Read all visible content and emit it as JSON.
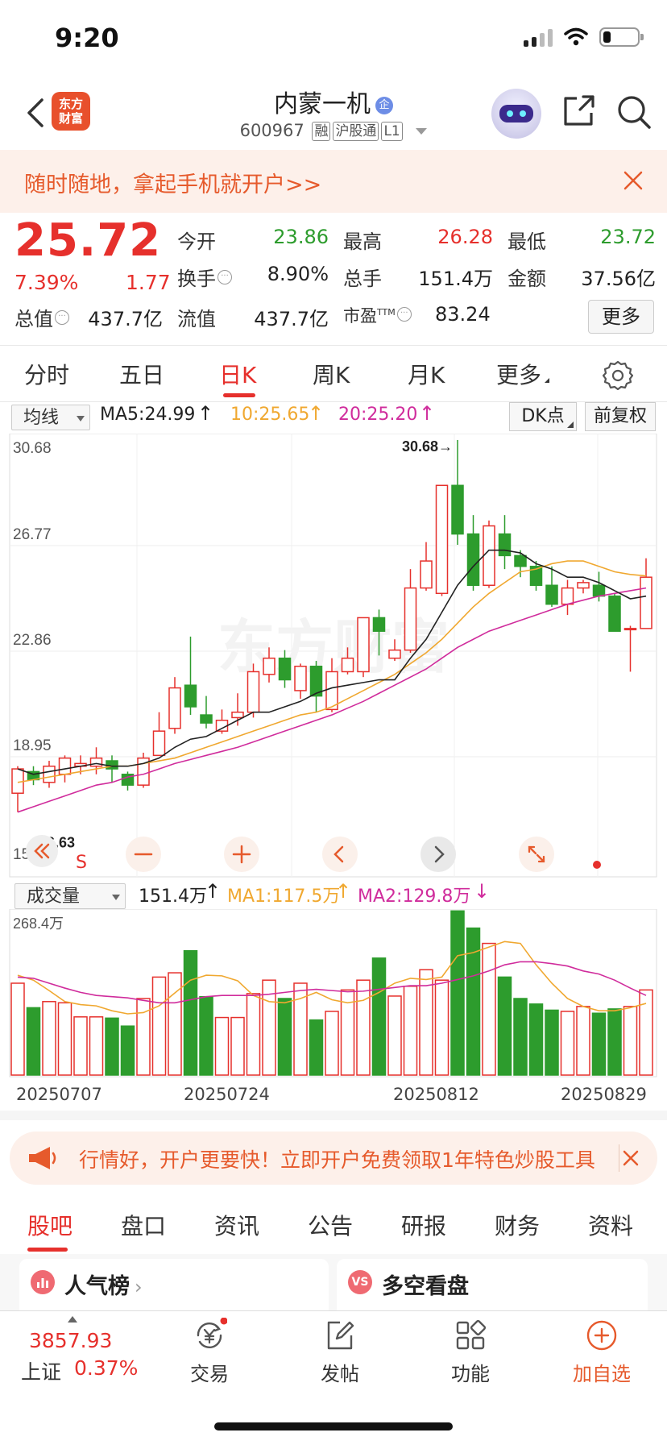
{
  "status_bar": {
    "time": "9:20",
    "battery_level": 0.22
  },
  "header": {
    "logo_line1": "东方",
    "logo_line2": "财富",
    "stock_name": "内蒙一机",
    "ent_badge": "企",
    "stock_code": "600967",
    "tags": [
      "融",
      "沪股通",
      "L1"
    ]
  },
  "promo": {
    "text": "随时随地，拿起手机就开户>>"
  },
  "quote": {
    "price": "25.72",
    "change_pct": "7.39%",
    "change": "1.77",
    "open_label": "今开",
    "open": "23.86",
    "high_label": "最高",
    "high": "26.28",
    "low_label": "最低",
    "low": "23.72",
    "turnover_label": "换手",
    "turnover": "8.90%",
    "volume_label": "总手",
    "volume": "151.4万",
    "amount_label": "金额",
    "amount": "37.56亿",
    "mcap_label": "总值",
    "mcap": "437.7亿",
    "float_label": "流值",
    "float_mcap": "437.7亿",
    "pe_label": "市盈",
    "pe_sup": "TTM",
    "pe": "83.24",
    "more_label": "更多"
  },
  "period_tabs": {
    "items": [
      "分时",
      "五日",
      "日K",
      "周K",
      "月K",
      "更多"
    ],
    "active": 2
  },
  "ma_bar": {
    "selector": "均线",
    "ma5": "MA5:24.99",
    "ma10": "10:25.65",
    "ma20": "20:25.20",
    "dk": "DK点",
    "adjust": "前复权",
    "ma5_color": "#222222",
    "ma10_color": "#f0a830",
    "ma20_color": "#d02c9c"
  },
  "vol_bar": {
    "selector": "成交量",
    "vol": "151.4万",
    "ma1": "MA1:117.5万",
    "ma2": "MA2:129.8万",
    "max_label": "268.4万"
  },
  "chart_labels": {
    "high_mark": "30.68→",
    "low_mark": "←16.63",
    "s_mark": "S",
    "watermark": "东方财富"
  },
  "chart_data": {
    "type": "candlestick",
    "y_ticks": [
      "30.68",
      "26.77",
      "22.86",
      "18.95",
      "15.04"
    ],
    "ylim": [
      15.04,
      30.68
    ],
    "x_labels": [
      "20250707",
      "20250724",
      "20250812",
      "20250829"
    ],
    "candles": [
      [
        17.6,
        18.5,
        16.9,
        18.6
      ],
      [
        18.4,
        18.1,
        17.9,
        18.6
      ],
      [
        18.0,
        18.6,
        17.8,
        18.8
      ],
      [
        18.3,
        18.9,
        18.0,
        19.0
      ],
      [
        18.6,
        18.7,
        18.3,
        19.0
      ],
      [
        18.6,
        18.9,
        18.3,
        19.3
      ],
      [
        18.8,
        18.5,
        18.0,
        19.0
      ],
      [
        18.3,
        17.9,
        17.7,
        18.4
      ],
      [
        17.9,
        18.9,
        17.8,
        19.1
      ],
      [
        19.0,
        19.9,
        19.0,
        20.6
      ],
      [
        20.0,
        21.5,
        19.8,
        21.9
      ],
      [
        21.6,
        20.8,
        20.5,
        23.4
      ],
      [
        20.5,
        20.2,
        20.0,
        21.2
      ],
      [
        19.9,
        20.3,
        19.8,
        20.7
      ],
      [
        20.4,
        20.6,
        20.1,
        21.3
      ],
      [
        20.6,
        22.1,
        20.4,
        22.4
      ],
      [
        22.0,
        22.6,
        21.7,
        23.0
      ],
      [
        22.6,
        21.8,
        21.5,
        22.9
      ],
      [
        21.4,
        22.3,
        21.1,
        22.4
      ],
      [
        22.3,
        21.2,
        20.6,
        22.5
      ],
      [
        20.7,
        22.1,
        20.6,
        22.6
      ],
      [
        22.1,
        22.6,
        22.0,
        23.0
      ],
      [
        22.1,
        24.1,
        21.9,
        24.1
      ],
      [
        24.1,
        23.6,
        22.7,
        24.4
      ],
      [
        22.6,
        22.9,
        22.5,
        23.3
      ],
      [
        22.9,
        25.2,
        22.8,
        25.9
      ],
      [
        25.2,
        26.2,
        25.1,
        26.9
      ],
      [
        25.0,
        29.0,
        24.9,
        29.0
      ],
      [
        29.0,
        27.2,
        26.8,
        30.68
      ],
      [
        27.2,
        25.3,
        25.1,
        27.9
      ],
      [
        25.3,
        27.5,
        25.2,
        27.7
      ],
      [
        27.2,
        26.4,
        25.9,
        27.9
      ],
      [
        26.4,
        26.0,
        25.6,
        26.6
      ],
      [
        26.0,
        25.3,
        25.1,
        26.2
      ],
      [
        25.3,
        24.6,
        24.5,
        26.0
      ],
      [
        24.6,
        25.2,
        24.2,
        25.5
      ],
      [
        25.2,
        25.4,
        25.0,
        25.5
      ],
      [
        25.3,
        24.9,
        24.7,
        25.8
      ],
      [
        24.9,
        23.6,
        23.6,
        25.0
      ],
      [
        23.7,
        23.7,
        22.1,
        23.8
      ],
      [
        23.7,
        25.6,
        23.7,
        26.3
      ]
    ],
    "ma5": [
      18.5,
      18.3,
      18.4,
      18.5,
      18.6,
      18.7,
      18.6,
      18.6,
      18.7,
      18.9,
      19.3,
      19.6,
      19.7,
      20.0,
      20.3,
      20.6,
      20.6,
      20.8,
      21.0,
      21.3,
      21.5,
      21.6,
      21.7,
      21.8,
      21.8,
      22.6,
      23.3,
      24.3,
      25.3,
      26.0,
      26.6,
      26.6,
      26.5,
      26.1,
      25.9,
      25.6,
      25.6,
      25.4,
      25.1,
      24.8,
      24.9
    ],
    "ma10": [
      18.0,
      18.1,
      18.2,
      18.3,
      18.4,
      18.5,
      18.6,
      18.6,
      18.7,
      18.8,
      18.9,
      19.1,
      19.3,
      19.5,
      19.7,
      19.9,
      20.1,
      20.3,
      20.5,
      20.6,
      20.8,
      21.1,
      21.4,
      21.7,
      22.0,
      22.4,
      22.8,
      23.3,
      23.9,
      24.5,
      25.0,
      25.4,
      25.8,
      25.9,
      26.1,
      26.2,
      26.2,
      26.0,
      25.8,
      25.7,
      25.65
    ],
    "ma20": [
      16.9,
      17.1,
      17.3,
      17.5,
      17.7,
      17.9,
      18.0,
      18.2,
      18.3,
      18.5,
      18.7,
      18.85,
      19.0,
      19.15,
      19.3,
      19.5,
      19.7,
      19.9,
      20.1,
      20.3,
      20.5,
      20.75,
      21.0,
      21.3,
      21.6,
      21.9,
      22.2,
      22.6,
      23.0,
      23.3,
      23.6,
      23.8,
      24.0,
      24.2,
      24.4,
      24.6,
      24.75,
      24.9,
      25.0,
      25.1,
      25.2
    ],
    "volume": [
      150,
      110,
      120,
      118,
      95,
      95,
      93,
      80,
      125,
      160,
      167,
      203,
      128,
      94,
      94,
      133,
      155,
      125,
      150,
      90,
      104,
      139,
      155,
      191,
      129,
      145,
      172,
      155,
      268,
      240,
      215,
      160,
      125,
      116,
      106,
      104,
      112,
      101,
      108,
      112,
      139
    ],
    "vol_ma1": [
      163,
      155,
      138,
      120,
      115,
      113,
      105,
      100,
      102,
      113,
      134,
      155,
      163,
      162,
      154,
      130,
      120,
      118,
      125,
      135,
      123,
      118,
      122,
      135,
      150,
      158,
      156,
      160,
      195,
      200,
      209,
      218,
      215,
      180,
      150,
      125,
      112,
      105,
      105,
      110,
      117
    ],
    "vol_ma2": [
      160,
      158,
      150,
      142,
      135,
      130,
      128,
      126,
      122,
      118,
      118,
      123,
      128,
      130,
      130,
      130,
      132,
      135,
      138,
      140,
      138,
      136,
      137,
      140,
      143,
      146,
      146,
      150,
      156,
      162,
      170,
      180,
      185,
      185,
      182,
      178,
      170,
      165,
      155,
      142,
      130
    ],
    "vol_max": 268.4
  },
  "ad": {
    "text": "行情好，开户更要快！立即开户免费领取1年特色炒股工具"
  },
  "content_tabs": {
    "items": [
      "股吧",
      "盘口",
      "资讯",
      "公告",
      "研报",
      "财务",
      "资料"
    ],
    "active": 0
  },
  "cards": [
    {
      "icon": "📊",
      "title": "人气榜"
    },
    {
      "icon": "VS",
      "title": "多空看盘"
    }
  ],
  "bottom": {
    "index_value": "3857.93",
    "index_name": "上证",
    "index_pct": "0.37%",
    "items": [
      {
        "label": "交易"
      },
      {
        "label": "发帖"
      },
      {
        "label": "功能"
      },
      {
        "label": "加自选"
      }
    ]
  },
  "colors": {
    "up": "#e6302c",
    "down": "#2d9c2d",
    "accent": "#e65a2c"
  }
}
